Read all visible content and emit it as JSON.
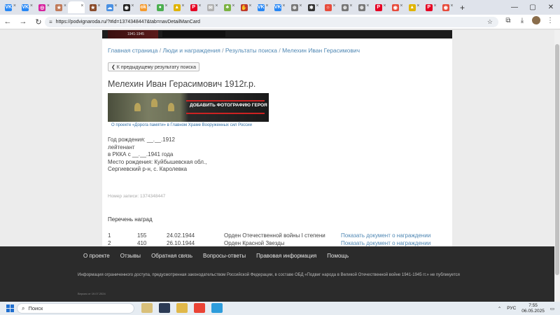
{
  "browser": {
    "tabs": [
      {
        "icon": "vk-icon",
        "color": "#2787f5",
        "glyph": "VK"
      },
      {
        "icon": "vk-icon",
        "color": "#2787f5",
        "glyph": "VK"
      },
      {
        "icon": "instagram-icon",
        "color": "#d6249f",
        "glyph": "◎"
      },
      {
        "icon": "star-icon",
        "color": "#c07a5a",
        "glyph": "★"
      },
      {
        "icon": "page-icon",
        "color": "#ffffff",
        "glyph": "",
        "active": true
      },
      {
        "icon": "medal-icon",
        "color": "#8a4b2b",
        "glyph": "★"
      },
      {
        "icon": "cloud-icon",
        "color": "#4a90e2",
        "glyph": "☁"
      },
      {
        "icon": "eye-icon",
        "color": "#222222",
        "glyph": "◉"
      },
      {
        "icon": "ok-icon",
        "color": "#f59a2e",
        "glyph": "ok"
      },
      {
        "icon": "green-icon",
        "color": "#4caf50",
        "glyph": "●"
      },
      {
        "icon": "yellow-icon",
        "color": "#e0b400",
        "glyph": "▲"
      },
      {
        "icon": "pinterest-icon",
        "color": "#e60023",
        "glyph": "P"
      },
      {
        "icon": "mail-icon",
        "color": "#b0b0b0",
        "glyph": "✉"
      },
      {
        "icon": "leaf-icon",
        "color": "#7cb342",
        "glyph": "♣"
      },
      {
        "icon": "hand-icon",
        "color": "#c0392b",
        "glyph": "✋"
      },
      {
        "icon": "vk-icon",
        "color": "#2787f5",
        "glyph": "VK"
      },
      {
        "icon": "vk-icon",
        "color": "#2787f5",
        "glyph": "VK"
      },
      {
        "icon": "globe-icon",
        "color": "#777777",
        "glyph": "⊕"
      },
      {
        "icon": "spider-icon",
        "color": "#333333",
        "glyph": "✱"
      },
      {
        "icon": "sun-icon",
        "color": "#e74c3c",
        "glyph": "☼"
      },
      {
        "icon": "globe-icon",
        "color": "#777777",
        "glyph": "⊕"
      },
      {
        "icon": "globe-icon",
        "color": "#777777",
        "glyph": "⊕"
      },
      {
        "icon": "pinterest-icon",
        "color": "#e60023",
        "glyph": "P"
      },
      {
        "icon": "red-icon",
        "color": "#e74c3c",
        "glyph": "◉"
      },
      {
        "icon": "yellow-icon",
        "color": "#e0b400",
        "glyph": "▲"
      },
      {
        "icon": "pinterest-icon",
        "color": "#e60023",
        "glyph": "P"
      },
      {
        "icon": "red-icon",
        "color": "#e74c3c",
        "glyph": "◉"
      }
    ],
    "close_glyph": "×",
    "newtab_glyph": "+",
    "url": "https://podvignaroda.ru/?#id=1374348447&tab=navDetailManCard",
    "site_icon": "≡"
  },
  "site": {
    "logo_years": "1941-1945"
  },
  "breadcrumb": {
    "home": "Главная страница",
    "sep": " / ",
    "people": "Люди и награждения",
    "results": "Результаты поиска",
    "current": "Мелехин Иван Герасимович"
  },
  "back_button": "❮ К предыдущему результату поиска",
  "person": {
    "title": "Мелехин Иван Герасимович 1912г.р.",
    "banner_button": "ДОБАВИТЬ ФОТОГРАФИЮ ГЕРОЯ",
    "banner_caption": "О проекте «Дорога памяти» в Главном Храме Вооруженных сил России",
    "birth_date": "Год рождения: __.__.1912",
    "rank": "лейтенант",
    "army_since": "в РККА с __.__.1941 года",
    "birth_place_1": "Место рождения: Куйбышевская обл.,",
    "birth_place_2": "Сергиевский р-н, с. Каролевка",
    "record_number": "Номер записи: 1374348447"
  },
  "awards": {
    "heading": "Перечень наград",
    "rows": [
      {
        "n": "1",
        "code": "155",
        "date": "24.02.1944",
        "name": "Орден Отечественной войны I степени",
        "link": "Показать документ о награждении"
      },
      {
        "n": "2",
        "code": "410",
        "date": "26.10.1944",
        "name": "Орден Красной Звезды",
        "link": "Показать документ о награждении"
      }
    ]
  },
  "footer": {
    "nav": [
      "О проекте",
      "Отзывы",
      "Обратная связь",
      "Вопросы-ответы",
      "Правовая информация",
      "Помощь"
    ],
    "notice": "Информация ограниченного доступа, предусмотренная законодательством Российской Федерации, в составе ОБД «Подвиг народа в Великой Отечественной войне 1941-1945 гг.» не публикуется",
    "version": "Версия от 19.07.2024"
  },
  "taskbar": {
    "search_placeholder": "Поиск",
    "lang": "РУС",
    "time": "7:55",
    "date": "06.05.2025",
    "apps": [
      "#d9c07a",
      "#2b3a55",
      "#e0b84a",
      "#ea4335",
      "#2d9cdb"
    ]
  }
}
